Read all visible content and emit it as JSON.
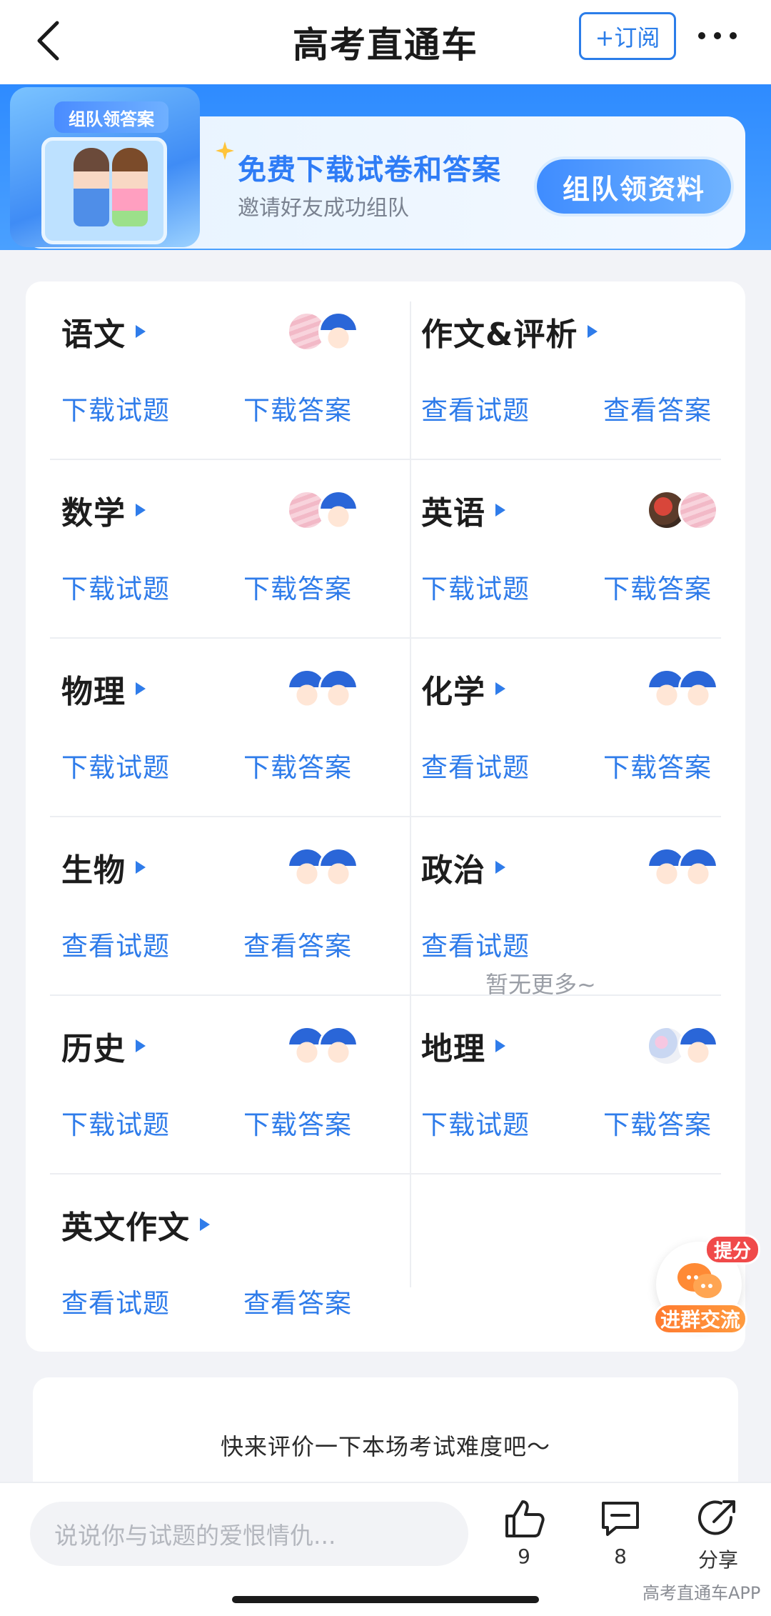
{
  "nav": {
    "title": "高考直通车",
    "subscribe_label": "+订阅",
    "back_icon": "chevron-left-icon",
    "more_icon": "more-dots-icon"
  },
  "banner": {
    "art_title": "组队领答案",
    "headline": "免费下载试卷和答案",
    "subline": "邀请好友成功组队",
    "button_label": "组队领资料",
    "accent": "#2e7cf6"
  },
  "subjects": [
    {
      "name": "语文",
      "link1": "下载试题",
      "link2": "下载答案",
      "avatars": [
        "pink",
        "robot"
      ]
    },
    {
      "name": "作文&评析",
      "link1": "查看试题",
      "link2": "查看答案",
      "avatars": []
    },
    {
      "name": "数学",
      "link1": "下载试题",
      "link2": "下载答案",
      "avatars": [
        "pink",
        "robot"
      ]
    },
    {
      "name": "英语",
      "link1": "下载试题",
      "link2": "下载答案",
      "avatars": [
        "photo",
        "pink"
      ]
    },
    {
      "name": "物理",
      "link1": "下载试题",
      "link2": "下载答案",
      "avatars": [
        "robot",
        "robot"
      ]
    },
    {
      "name": "化学",
      "link1": "查看试题",
      "link2": "下载答案",
      "avatars": [
        "robot",
        "robot"
      ]
    },
    {
      "name": "生物",
      "link1": "查看试题",
      "link2": "查看答案",
      "avatars": [
        "robot",
        "robot"
      ]
    },
    {
      "name": "政治",
      "link1": "查看试题",
      "link2": "",
      "avatars": [
        "robot",
        "robot"
      ]
    },
    {
      "name": "历史",
      "link1": "下载试题",
      "link2": "下载答案",
      "avatars": [
        "robot",
        "robot"
      ]
    },
    {
      "name": "地理",
      "link1": "下载试题",
      "link2": "下载答案",
      "avatars": [
        "floral",
        "robot"
      ]
    },
    {
      "name": "英文作文",
      "link1": "查看试题",
      "link2": "查看答案",
      "avatars": []
    }
  ],
  "empty_more": "暂无更多~",
  "float_chat": {
    "badge": "提分",
    "label": "进群交流"
  },
  "rating_prompt": "快来评价一下本场考试难度吧～",
  "bottom": {
    "input_placeholder": "说说你与试题的爱恨情仇...",
    "like_count": "9",
    "comment_count": "8",
    "share_label": "分享"
  },
  "watermark": "高考直通车APP",
  "colors": {
    "link": "#2f7cea",
    "brand_blue": "#2b7de9",
    "badge_red": "#f04a4a",
    "chat_orange": "#ff8a35"
  }
}
